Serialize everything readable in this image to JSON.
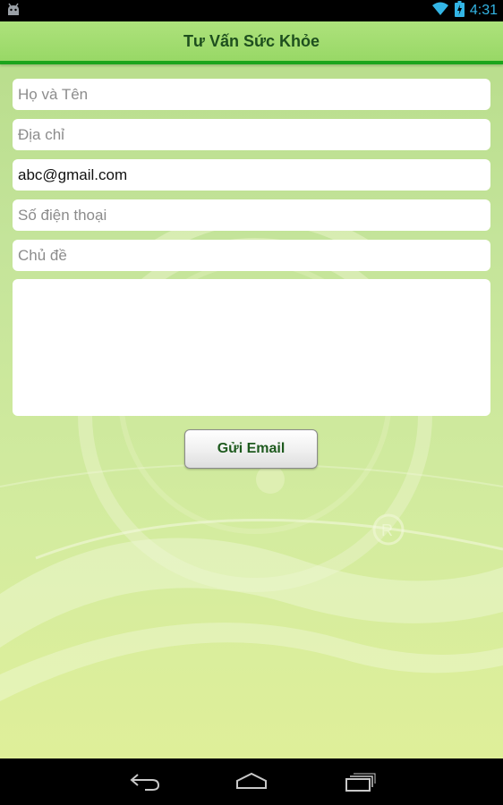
{
  "status_bar": {
    "time": "4:31",
    "icons": [
      "android-notification-icon",
      "wifi-icon",
      "battery-charging-icon"
    ]
  },
  "app": {
    "title": "Tư Vấn Sức Khỏe"
  },
  "form": {
    "name_placeholder": "Họ và Tên",
    "address_placeholder": "Địa chỉ",
    "email_value": "abc@gmail.com",
    "phone_placeholder": "Số điện thoại",
    "subject_placeholder": "Chủ đề",
    "message_value": "",
    "send_label": "Gửi Email"
  },
  "nav_bar": {
    "buttons": [
      "back-icon",
      "home-icon",
      "recent-apps-icon"
    ]
  },
  "colors": {
    "title_bar": "#a6df75",
    "title_underline": "#1ca51c",
    "title_text": "#1e4f1e",
    "background": "#c8e69c",
    "button_text": "#1e5a1e",
    "status_accent": "#33b5e5"
  }
}
